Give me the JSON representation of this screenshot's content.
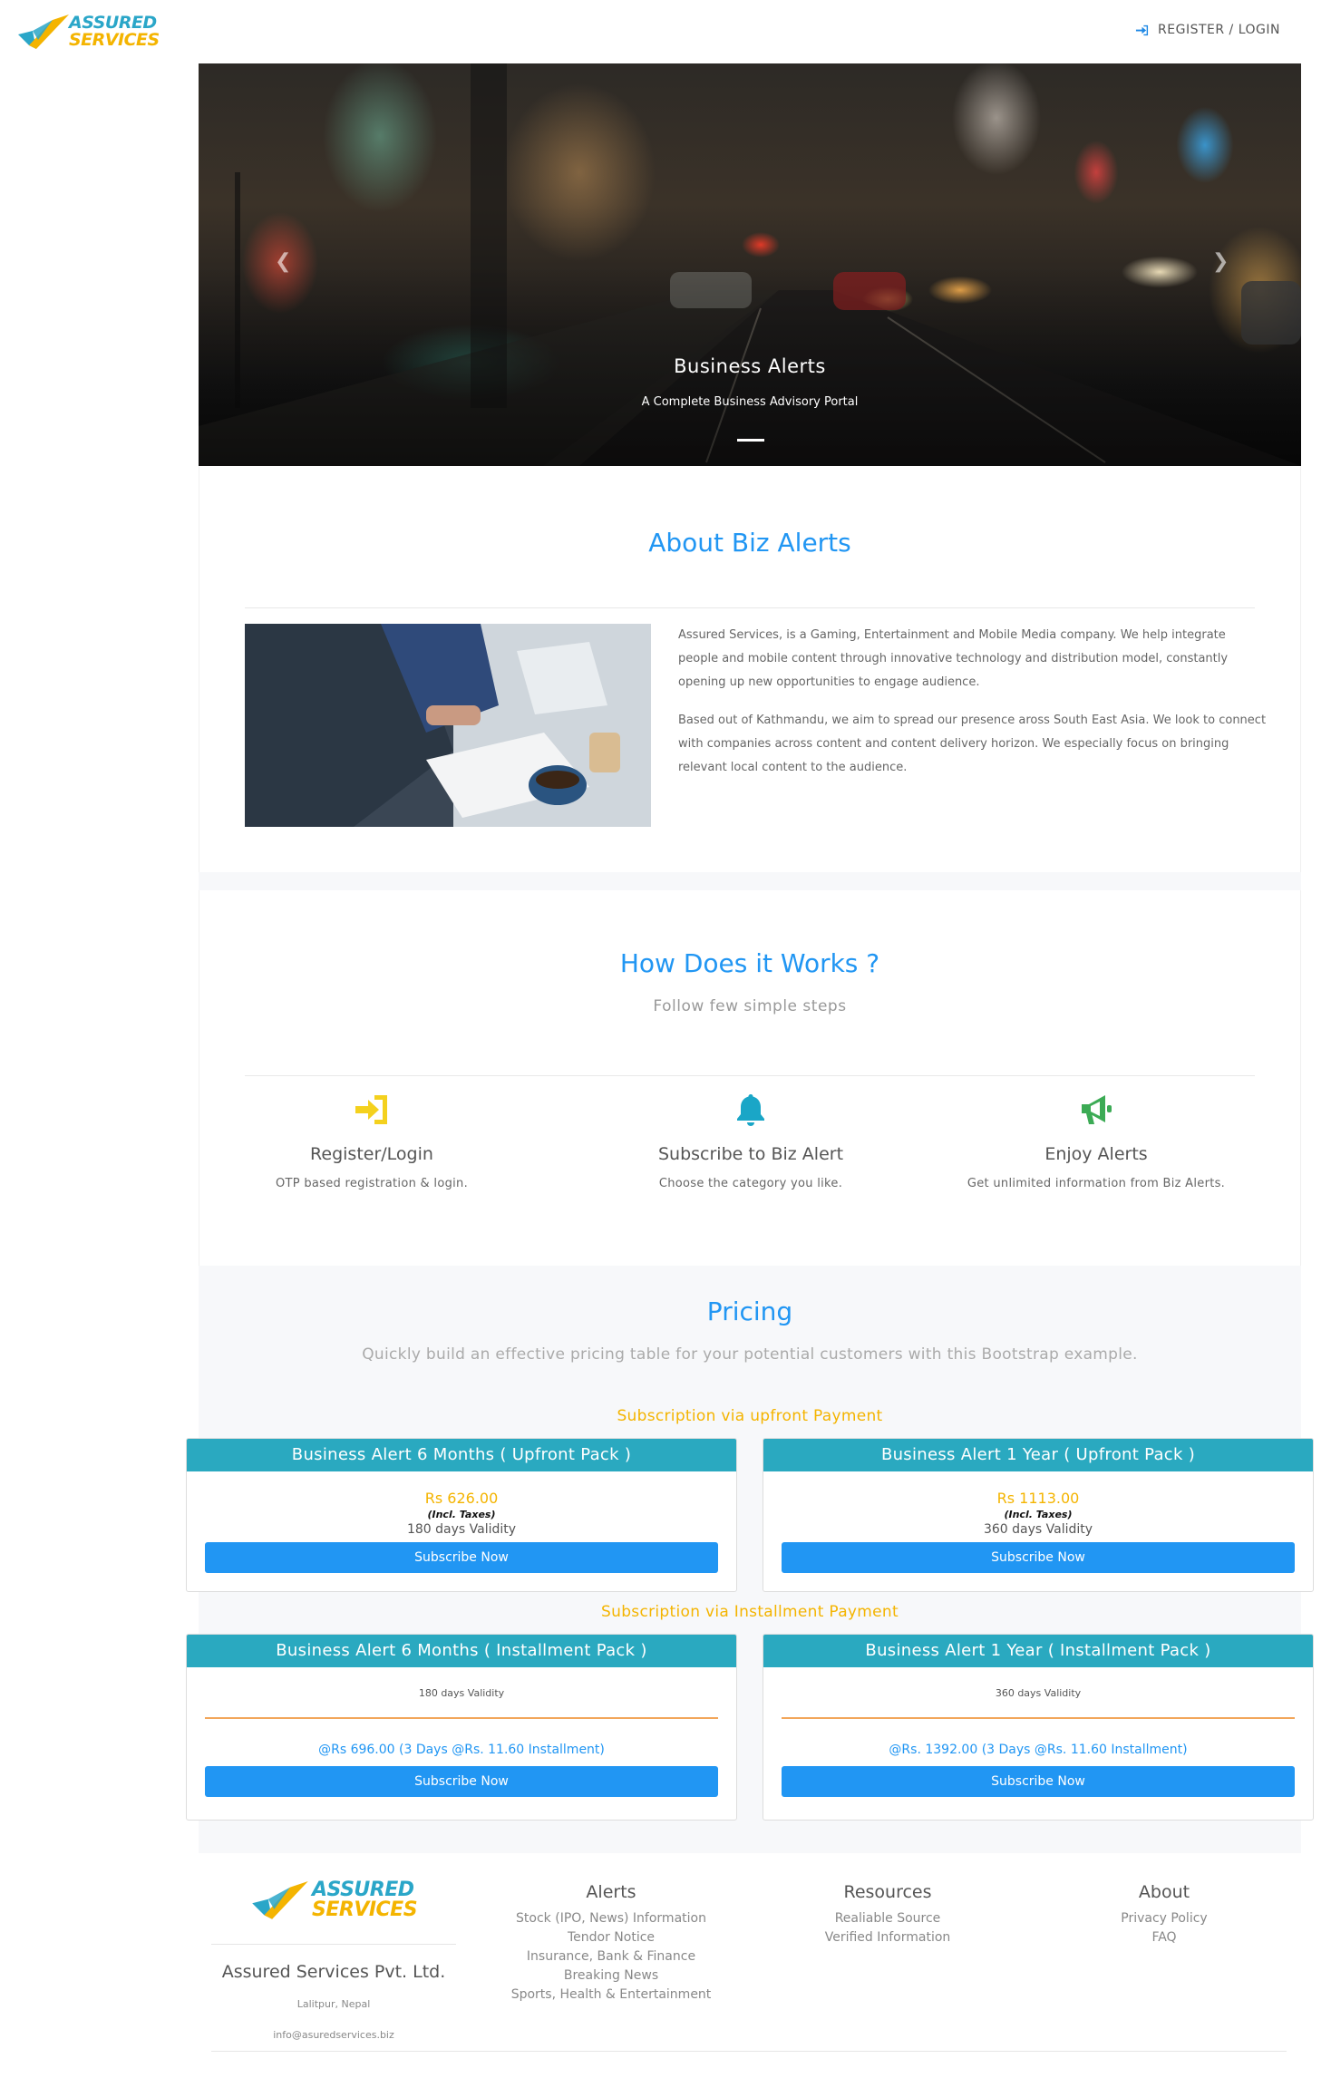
{
  "brand": {
    "logo_line1": "ASSURED",
    "logo_line2": "SERVICES",
    "colors": {
      "blue": "#2aa6c8",
      "yellow": "#f4b400",
      "accent": "#2196f3"
    }
  },
  "header": {
    "login_icon": "sign-in-icon",
    "login_label": "REGISTER / LOGIN"
  },
  "hero": {
    "title": "Business Alerts",
    "subtitle": "A Complete Business Advisory Portal",
    "prev_icon": "chevron-left-icon",
    "next_icon": "chevron-right-icon"
  },
  "about": {
    "title": "About Biz Alerts",
    "paragraph1": "Assured Services, is a Gaming, Entertainment and Mobile Media company. We help integrate people and mobile content through innovative technology and distribution model, constantly opening up new opportunities to engage audience.",
    "paragraph2": "Based out of Kathmandu, we aim to spread our presence aross South East Asia. We look to connect with companies across content and content delivery horizon. We especially focus on bringing relevant local content to the audience."
  },
  "how": {
    "title": "How Does it Works ?",
    "subtitle": "Follow few simple steps",
    "steps": [
      {
        "icon": "sign-in-icon",
        "title": "Register/Login",
        "desc": "OTP based registration & login.",
        "color": "#f4d11e"
      },
      {
        "icon": "bell-icon",
        "title": "Subscribe to Biz Alert",
        "desc": "Choose the category you like.",
        "color": "#1aa6c7"
      },
      {
        "icon": "megaphone-icon",
        "title": "Enjoy Alerts",
        "desc": "Get unlimited information from Biz Alerts.",
        "color": "#3cab55"
      }
    ]
  },
  "pricing": {
    "title": "Pricing",
    "subtitle": "Quickly build an effective pricing table for your potential customers with this Bootstrap example.",
    "upfront_label": "Subscription via upfront Payment",
    "installment_label": "Subscription via Installment Payment",
    "upfront": [
      {
        "title": "Business Alert 6 Months ( Upfront Pack )",
        "price": "Rs 626.00",
        "tax": "(Incl. Taxes)",
        "validity": "180 days Validity",
        "button": "Subscribe Now"
      },
      {
        "title": "Business Alert 1 Year ( Upfront Pack )",
        "price": "Rs 1113.00",
        "tax": "(Incl. Taxes)",
        "validity": "360 days Validity",
        "button": "Subscribe Now"
      }
    ],
    "installment": [
      {
        "title": "Business Alert 6 Months ( Installment Pack )",
        "validity": "180 days Validity",
        "installment": "@Rs 696.00 (3 Days @Rs. 11.60 Installment)",
        "button": "Subscribe Now"
      },
      {
        "title": "Business Alert 1 Year ( Installment Pack )",
        "validity": "360 days Validity",
        "installment": "@Rs. 1392.00 (3 Days @Rs. 11.60 Installment)",
        "button": "Subscribe Now"
      }
    ]
  },
  "footer": {
    "company": "Assured Services Pvt. Ltd.",
    "location": "Lalitpur, Nepal",
    "email": "info@asuredservices.biz",
    "columns": [
      {
        "title": "Alerts",
        "links": [
          "Stock (IPO, News) Information",
          "Tendor Notice",
          "Insurance, Bank & Finance",
          "Breaking News",
          "Sports, Health & Entertainment"
        ]
      },
      {
        "title": "Resources",
        "links": [
          "Realiable Source",
          "Verified Information"
        ]
      },
      {
        "title": "About",
        "links": [
          "Privacy Policy",
          "FAQ"
        ]
      }
    ]
  }
}
